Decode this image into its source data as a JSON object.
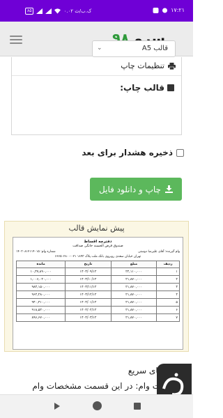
{
  "status_bar": {
    "clock": "۱۷:۲۱",
    "speed": "۰.۰۲ ک.ب/ث",
    "battery": "۸۵"
  },
  "header": {
    "logo_word": "سرو",
    "logo_number": "۹۸"
  },
  "settings": {
    "title": "تنظیمات چاپ",
    "template_label": "قالب چاپ:",
    "template_value": "قالب A5",
    "warning_checkbox_label": "ذخیره هشدار برای بعد",
    "download_button": "چاپ و دانلود فایل"
  },
  "preview": {
    "title": "پیش نمایش قالب",
    "doc_title": "دفترچه اقساط",
    "doc_subtitle": "صندوق قرض الحسنه خانگی صداقت",
    "borrower": "وام گیرنده: آقای علیرضا دوستی",
    "loan_number": "شماره وام: ۱۴۰۳۰۸۱۲۱۱۴۰۱۵",
    "address": "تهران خیابان سعدی روبروی بانک ملت پلاک ۱۸۹۳ ۰۲۱-۶۶۶۵۰۲۸۰۰",
    "columns": [
      "ردیف",
      "مبلغ",
      "تاریخ",
      "مانده"
    ],
    "rows": [
      [
        "۱",
        "۲۲,۱۱۰,۰۰۰",
        "۱۴۰۳/۰۹/۱۲",
        "۱۰,۳۷,۸۹۰,۰۰۰"
      ],
      [
        "۲",
        "۲۱,۸۷۰,۰۰۰",
        "۱۴۰۳/۱۰/۱۲",
        "۱,۰۰۶,۰۲۰,۰۰۰"
      ],
      [
        "۳",
        "۲۱,۸۷۰,۰۰۰",
        "۱۴۰۳/۱۱/۱۲",
        "۹۸۴,۱۵۰,۰۰۰"
      ],
      [
        "۴",
        "۲۱,۸۷۰,۰۰۰",
        "۱۴۰۳/۱۲/۱۲",
        "۹۶۲,۲۸۰,۰۰۰"
      ],
      [
        "۵",
        "۲۱,۸۷۰,۰۰۰",
        "۱۴۰۴/۰۱/۱۲",
        "۹۴۰,۴۱۰,۰۰۰"
      ],
      [
        "۶",
        "۲۱,۸۷۰,۰۰۰",
        "۱۴۰۴/۰۲/۱۲",
        "۹۱۸,۵۴۰,۰۰۰"
      ],
      [
        "۷",
        "۲۱,۸۷۰,۰۰۰",
        "۱۴۰۴/۰۳/۱۲",
        "۸۹۶,۶۷۰,۰۰۰"
      ]
    ]
  },
  "guide": {
    "title": "راهنمای سریع",
    "text": "مشخصات وام: در این قسمت مشخصات وام"
  },
  "colors": {
    "status_bar": "#6f00d6",
    "button": "#5cb85c",
    "logo_number": "#2f9a3b"
  }
}
